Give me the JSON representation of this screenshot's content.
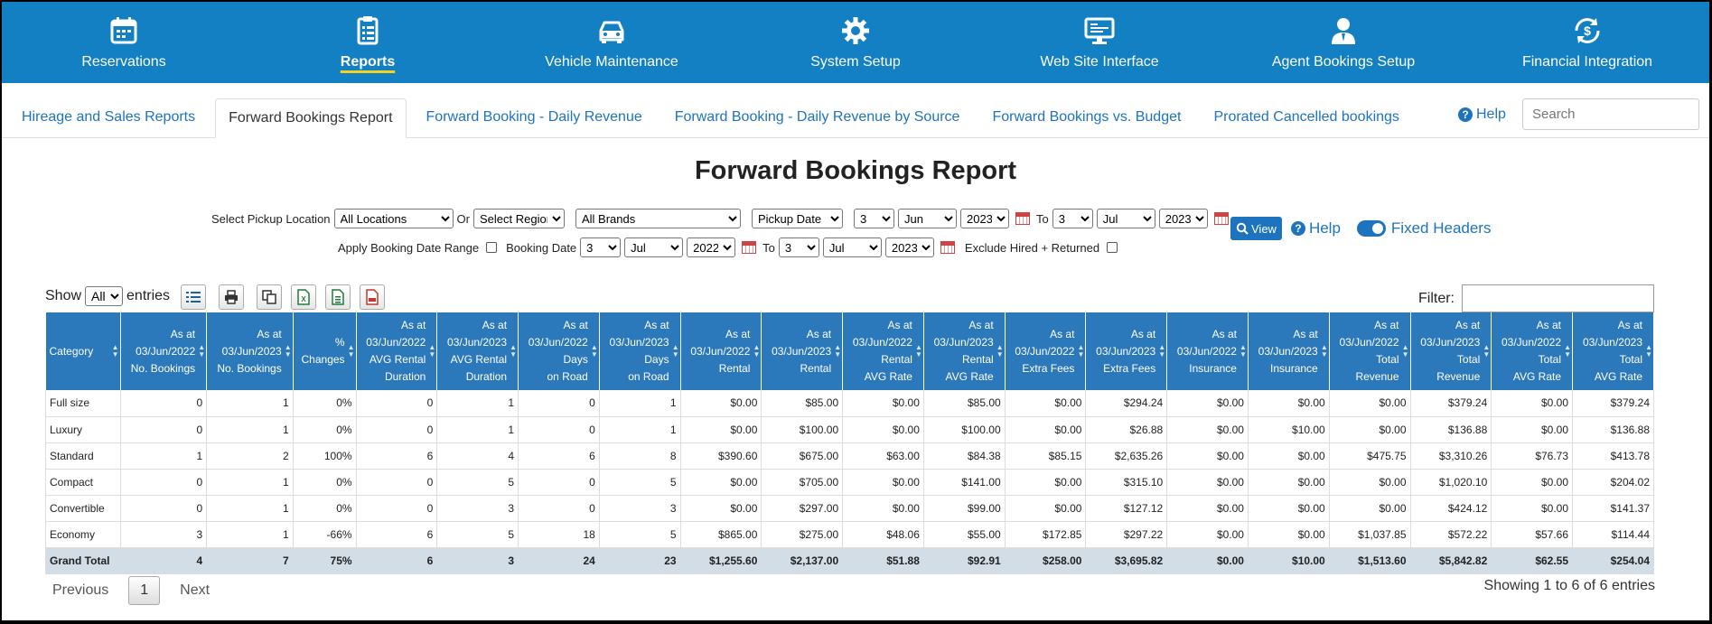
{
  "nav": {
    "items": [
      {
        "label": "Reservations",
        "icon": "calendar-icon"
      },
      {
        "label": "Reports",
        "icon": "clipboard-list-icon",
        "active": true
      },
      {
        "label": "Vehicle Maintenance",
        "icon": "car-icon"
      },
      {
        "label": "System Setup",
        "icon": "gear-icon"
      },
      {
        "label": "Web Site Interface",
        "icon": "monitor-icon"
      },
      {
        "label": "Agent Bookings Setup",
        "icon": "agent-icon"
      },
      {
        "label": "Financial Integration",
        "icon": "money-sync-icon"
      }
    ]
  },
  "tabs": {
    "items": [
      {
        "label": "Hireage and Sales Reports"
      },
      {
        "label": "Forward Bookings Report",
        "active": true
      },
      {
        "label": "Forward Booking - Daily Revenue"
      },
      {
        "label": "Forward Booking - Daily Revenue by Source"
      },
      {
        "label": "Forward Bookings vs. Budget"
      },
      {
        "label": "Prorated Cancelled bookings"
      }
    ],
    "help": "Help",
    "search_placeholder": "Search"
  },
  "page_title": "Forward Bookings Report",
  "filters": {
    "pickup_label": "Select Pickup Location",
    "location": "All Locations",
    "or_label": "Or",
    "region": "Select Region",
    "brand": "All Brands",
    "date_type": "Pickup Date",
    "from_day": "3",
    "from_month": "Jun",
    "from_year": "2023",
    "to_label": "To",
    "to_day": "3",
    "to_month": "Jul",
    "to_year": "2023",
    "view_label": "View",
    "help_label": "Help",
    "fixed_headers_label": "Fixed Headers",
    "apply_range_label": "Apply Booking Date Range",
    "booking_date_label": "Booking Date",
    "bk_from_day": "3",
    "bk_from_month": "Jul",
    "bk_from_year": "2022",
    "bk_to_label": "To",
    "bk_to_day": "3",
    "bk_to_month": "Jul",
    "bk_to_year": "2023",
    "exclude_label": "Exclude Hired + Returned"
  },
  "table_controls": {
    "show_label": "Show",
    "entries_value": "All",
    "entries_label": "entries",
    "filter_label": "Filter:"
  },
  "table": {
    "headers": [
      [
        "Category"
      ],
      [
        "As at",
        "03/Jun/2022",
        "No. Bookings"
      ],
      [
        "As at",
        "03/Jun/2023",
        "No. Bookings"
      ],
      [
        "%",
        "Changes"
      ],
      [
        "As at",
        "03/Jun/2022",
        "AVG Rental",
        "Duration"
      ],
      [
        "As at",
        "03/Jun/2023",
        "AVG Rental",
        "Duration"
      ],
      [
        "As at",
        "03/Jun/2022",
        "Days",
        "on Road"
      ],
      [
        "As at",
        "03/Jun/2023",
        "Days",
        "on Road"
      ],
      [
        "As at",
        "03/Jun/2022",
        "Rental"
      ],
      [
        "As at",
        "03/Jun/2023",
        "Rental"
      ],
      [
        "As at",
        "03/Jun/2022",
        "Rental",
        "AVG Rate"
      ],
      [
        "As at",
        "03/Jun/2023",
        "Rental",
        "AVG Rate"
      ],
      [
        "As at",
        "03/Jun/2022",
        "Extra Fees"
      ],
      [
        "As at",
        "03/Jun/2023",
        "Extra Fees"
      ],
      [
        "As at",
        "03/Jun/2022",
        "Insurance"
      ],
      [
        "As at",
        "03/Jun/2023",
        "Insurance"
      ],
      [
        "As at",
        "03/Jun/2022",
        "Total",
        "Revenue"
      ],
      [
        "As at",
        "03/Jun/2023",
        "Total",
        "Revenue"
      ],
      [
        "As at",
        "03/Jun/2022",
        "Total",
        "AVG Rate"
      ],
      [
        "As at",
        "03/Jun/2023",
        "Total",
        "AVG Rate"
      ]
    ],
    "rows": [
      [
        "Full size",
        "0",
        "1",
        "0%",
        "0",
        "1",
        "0",
        "1",
        "$0.00",
        "$85.00",
        "$0.00",
        "$85.00",
        "$0.00",
        "$294.24",
        "$0.00",
        "$0.00",
        "$0.00",
        "$379.24",
        "$0.00",
        "$379.24"
      ],
      [
        "Luxury",
        "0",
        "1",
        "0%",
        "0",
        "1",
        "0",
        "1",
        "$0.00",
        "$100.00",
        "$0.00",
        "$100.00",
        "$0.00",
        "$26.88",
        "$0.00",
        "$10.00",
        "$0.00",
        "$136.88",
        "$0.00",
        "$136.88"
      ],
      [
        "Standard",
        "1",
        "2",
        "100%",
        "6",
        "4",
        "6",
        "8",
        "$390.60",
        "$675.00",
        "$63.00",
        "$84.38",
        "$85.15",
        "$2,635.26",
        "$0.00",
        "$0.00",
        "$475.75",
        "$3,310.26",
        "$76.73",
        "$413.78"
      ],
      [
        "Compact",
        "0",
        "1",
        "0%",
        "0",
        "5",
        "0",
        "5",
        "$0.00",
        "$705.00",
        "$0.00",
        "$141.00",
        "$0.00",
        "$315.10",
        "$0.00",
        "$0.00",
        "$0.00",
        "$1,020.10",
        "$0.00",
        "$204.02"
      ],
      [
        "Convertible",
        "0",
        "1",
        "0%",
        "0",
        "3",
        "0",
        "3",
        "$0.00",
        "$297.00",
        "$0.00",
        "$99.00",
        "$0.00",
        "$127.12",
        "$0.00",
        "$0.00",
        "$0.00",
        "$424.12",
        "$0.00",
        "$141.37"
      ],
      [
        "Economy",
        "3",
        "1",
        "-66%",
        "6",
        "5",
        "18",
        "5",
        "$865.00",
        "$275.00",
        "$48.06",
        "$55.00",
        "$172.85",
        "$297.22",
        "$0.00",
        "$0.00",
        "$1,037.85",
        "$572.22",
        "$57.66",
        "$114.44"
      ]
    ],
    "total": [
      "Grand Total",
      "4",
      "7",
      "75%",
      "6",
      "3",
      "24",
      "23",
      "$1,255.60",
      "$2,137.00",
      "$51.88",
      "$92.91",
      "$258.00",
      "$3,695.82",
      "$0.00",
      "$10.00",
      "$1,513.60",
      "$5,842.82",
      "$62.55",
      "$254.04"
    ]
  },
  "pagination": {
    "previous": "Previous",
    "page": "1",
    "next": "Next",
    "info": "Showing 1 to 6 of 6 entries"
  },
  "colors": {
    "nav_bg": "#1280c2",
    "header_bg": "#2b78bb",
    "link": "#1e73be",
    "total_bg": "#d3dde6",
    "active_underline": "#f6d21c"
  }
}
